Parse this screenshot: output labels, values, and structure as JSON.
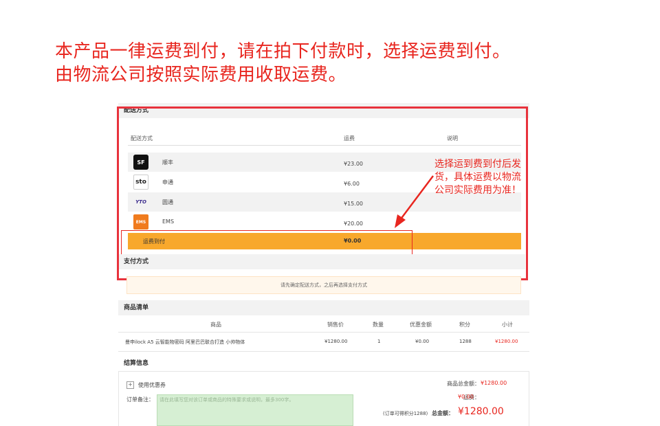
{
  "banner": {
    "line1": "本产品一律运费到付，请在拍下付款时，选择运费到付。",
    "line2": "由物流公司按照实际费用收取运费。"
  },
  "shipping": {
    "section_title": "配送方式",
    "col_method": "配送方式",
    "col_fee": "运费",
    "col_desc": "说明",
    "options": [
      {
        "logo": "SF",
        "name": "顺丰",
        "fee": "¥23.00"
      },
      {
        "logo": "sto",
        "name": "申通",
        "fee": "¥6.00"
      },
      {
        "logo": "YTO",
        "name": "圆通",
        "fee": "¥15.00"
      },
      {
        "logo": "EMS",
        "name": "EMS",
        "fee": "¥20.00"
      }
    ],
    "cod": {
      "name": "运费到付",
      "fee": "¥0.00"
    }
  },
  "annotation": "选择运到费到付后发货，具体运费以物流公司实际费用为准！",
  "payment": {
    "section_title": "支付方式",
    "message": "请先确定配送方式，之后再选择支付方式"
  },
  "goods": {
    "section_title": "商品清单",
    "headers": [
      "商品",
      "销售价",
      "数量",
      "优惠金额",
      "积分",
      "小计"
    ],
    "row": {
      "name": "曼申ilock A5 云智能物密码 阿里巴巴联合打造 小帅物体",
      "price": "¥1280.00",
      "qty": "1",
      "discount": "¥0.00",
      "points": "1288",
      "subtotal": "¥1280.00"
    }
  },
  "settlement": {
    "section_title": "结算信息",
    "coupon_label": "使用优惠券",
    "remark_label": "订单备注：",
    "remark_placeholder": "请在此填写您对该订单或商品的特殊要求或说明，最多300字。",
    "goods_total_label": "商品总金额：",
    "goods_total": "¥1280.00",
    "shipping_label": "运费：",
    "shipping": "¥0.00",
    "points_note": "(订单可得积分1288)",
    "grand_label": "总金额：",
    "grand_total": "¥1280.00"
  },
  "colors": {
    "accent_red": "#e8261f",
    "cod_orange": "#f8a82c"
  }
}
